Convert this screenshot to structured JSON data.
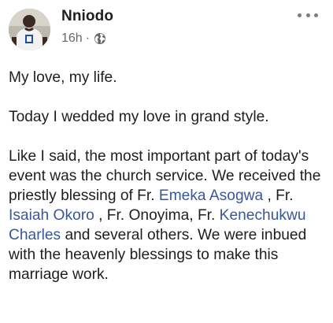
{
  "post": {
    "author": "Nniodo",
    "time": "16h",
    "separator": "·",
    "privacy_icon": "globe-icon",
    "more_icon": "more-options-icon",
    "paragraphs": {
      "p1": "My love, my life.",
      "p2": "Today I wedded my love in grand style.",
      "p3": {
        "t1": "Like I said, the most important part of today's event was the church service. We received the priestly blessing of Fr. ",
        "m1": "Emeka Asogwa",
        "t2": " , Fr. ",
        "m2": "Isaiah Okoro",
        "t3": " , Fr. Onoyima, Fr. ",
        "m3": "Kenechukwu Charles",
        "t4": " and several others. We were inbued with the heavenly blessings to make this marriage work."
      }
    }
  },
  "colors": {
    "link": "#385898",
    "text": "#1c1e21",
    "meta": "#65676b"
  }
}
